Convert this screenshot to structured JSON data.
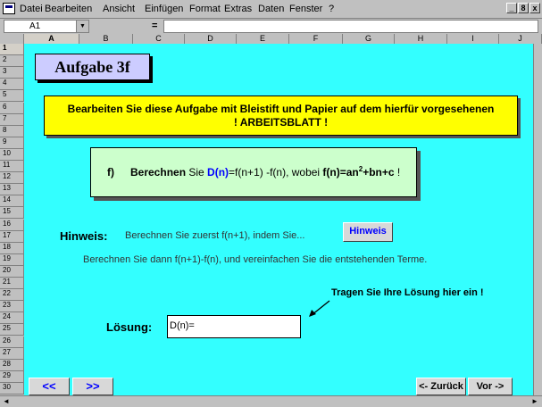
{
  "menu": {
    "items": [
      "Datei",
      "Bearbeiten",
      "Ansicht",
      "Einfügen",
      "Format",
      "Extras",
      "Daten",
      "Fenster",
      "?"
    ],
    "window_buttons": [
      "_",
      "8",
      "x"
    ]
  },
  "formula_bar": {
    "cell_ref": "A1",
    "equals": "=",
    "formula": ""
  },
  "columns": [
    "A",
    "B",
    "C",
    "D",
    "E",
    "F",
    "G",
    "H",
    "I",
    "J"
  ],
  "rows": [
    "1",
    "2",
    "3",
    "4",
    "5",
    "6",
    "7",
    "8",
    "9",
    "10",
    "11",
    "12",
    "13",
    "14",
    "15",
    "16",
    "17",
    "18",
    "19",
    "20",
    "21",
    "22",
    "23",
    "24",
    "25",
    "26",
    "27",
    "28",
    "29",
    "30"
  ],
  "sheet": {
    "title": "Aufgabe 3f",
    "instruction_line1": "Bearbeiten Sie diese Aufgabe mit Bleistift und Papier auf dem hierfür vorgesehenen",
    "instruction_line2": "! ARBEITSBLATT !",
    "task": {
      "label": "f)",
      "verb": "Berechnen",
      "sie": " Sie ",
      "dn": "D(n)",
      "formula": "=f(n+1) -f(n), wobei ",
      "fn": "f(n)=an",
      "exp": "2",
      "rest": "+bn+c",
      "end": " !"
    },
    "hint_label": "Hinweis:",
    "hint_text": "Berechnen Sie zuerst f(n+1),  indem Sie...",
    "hint_button": "Hinweis",
    "hint_text2": "Berechnen Sie dann  f(n+1)-f(n), und vereinfachen Sie die entstehenden Terme.",
    "answer_prompt": "Tragen Sie Ihre Lösung hier ein !",
    "answer_label": "Lösung:",
    "answer_value": "D(n)=",
    "nav": {
      "first": "<<",
      "next_page": ">>",
      "back": "<- Zurück",
      "forward": "Vor ->"
    }
  },
  "colors": {
    "sheet_bg": "#33ffff",
    "title_bg": "#ccccff",
    "instruction_bg": "#ffff00",
    "task_bg": "#ccffcc",
    "accent_blue": "#0000ff"
  }
}
